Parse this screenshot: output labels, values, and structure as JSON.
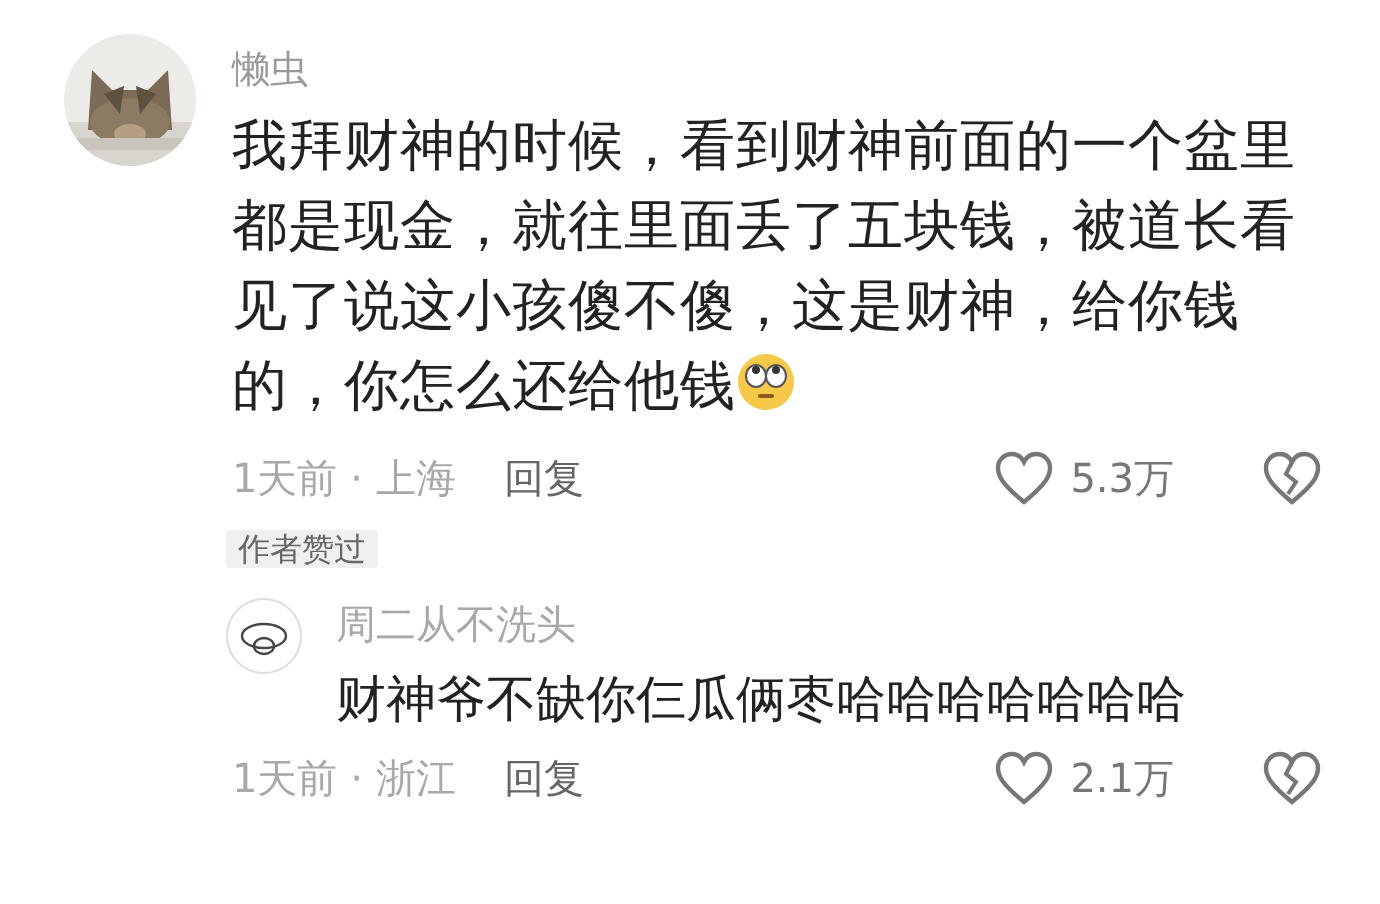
{
  "comment": {
    "author": "懒虫",
    "text": "我拜财神的时候，看到财神前面的一个盆里都是现金，就往里面丢了五块钱，被道长看见了说这小孩傻不傻，这是财神，给你钱的，你怎么还给他钱",
    "emoji": true,
    "meta": "1天前 · 上海",
    "reply_label": "回复",
    "likes": "5.3万",
    "badge": "作者赞过",
    "replies": [
      {
        "author": "周二从不洗头",
        "avatar": {
          "kind": "drawing"
        },
        "text": "财神爷不缺你仨瓜俩枣哈哈哈哈哈哈哈",
        "emoji": false,
        "meta": "1天前 · 浙江",
        "reply_label": "回复",
        "likes": "2.1万"
      }
    ]
  }
}
